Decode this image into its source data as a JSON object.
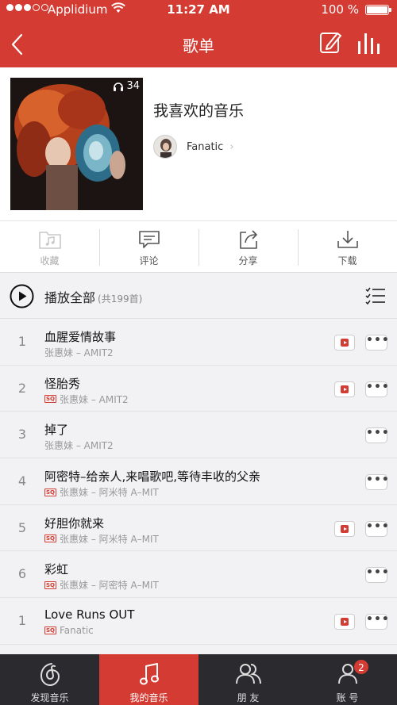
{
  "status": {
    "carrier": "Applidium",
    "time": "11:27 AM",
    "battery": "100 %"
  },
  "nav": {
    "title": "歌单"
  },
  "playlist": {
    "play_count": "34",
    "title": "我喜欢的音乐",
    "creator": "Fanatic",
    "creator_arrow": "›"
  },
  "actions": [
    {
      "label": "收藏",
      "icon": "folder-music-icon",
      "enabled": false
    },
    {
      "label": "评论",
      "icon": "comment-icon",
      "enabled": true
    },
    {
      "label": "分享",
      "icon": "share-icon",
      "enabled": true
    },
    {
      "label": "下载",
      "icon": "download-icon",
      "enabled": true
    }
  ],
  "play_all": {
    "label": "播放全部",
    "count": "(共199首)"
  },
  "songs": [
    {
      "index": "1",
      "title": "血腥爱情故事",
      "artist_album": "张惠妹 – AMIT2",
      "sq": false,
      "mv": true
    },
    {
      "index": "2",
      "title": "怪胎秀",
      "artist_album": "张惠妹 – AMIT2",
      "sq": true,
      "mv": true
    },
    {
      "index": "3",
      "title": "掉了",
      "artist_album": "张惠妹 – AMIT2",
      "sq": false,
      "mv": false
    },
    {
      "index": "4",
      "title": "阿密特–给亲人,来唱歌吧,等待丰收的父亲",
      "artist_album": "张惠妹 – 阿米特 A–MIT",
      "sq": true,
      "mv": false
    },
    {
      "index": "5",
      "title": "好胆你就来",
      "artist_album": "张惠妹 – 阿米特 A–MIT",
      "sq": true,
      "mv": true
    },
    {
      "index": "6",
      "title": "彩虹",
      "artist_album": "张惠妹 – 阿密特 A–MIT",
      "sq": true,
      "mv": false
    },
    {
      "index": "1",
      "title": "Love Runs OUT",
      "artist_album": "Fanatic",
      "sq": true,
      "mv": true
    }
  ],
  "sq_label": "SQ",
  "more_label": "•••",
  "tabs": [
    {
      "label": "发现音乐",
      "icon": "netease-logo-icon",
      "active": false
    },
    {
      "label": "我的音乐",
      "icon": "music-note-icon",
      "active": true
    },
    {
      "label": "朋 友",
      "icon": "friends-icon",
      "active": false
    },
    {
      "label": "账 号",
      "icon": "account-icon",
      "active": false,
      "badge": "2"
    }
  ],
  "colors": {
    "brand": "#d43c33",
    "tabbar": "#2b2b2f"
  }
}
